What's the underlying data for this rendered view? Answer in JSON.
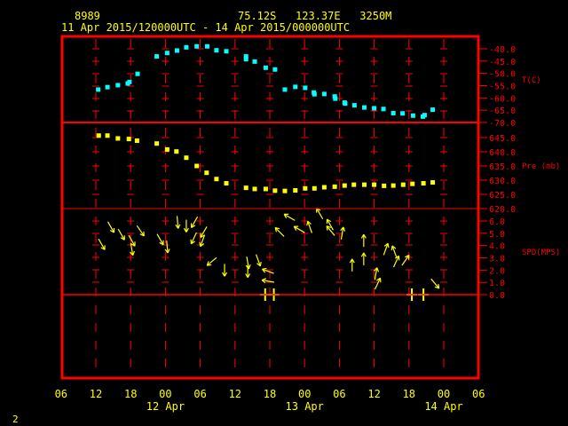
{
  "header": {
    "station_id": "8989",
    "location": "75.12S   123.37E   3250M",
    "period": "11 Apr 2015/120000UTC - 14 Apr 2015/000000UTC"
  },
  "page_number": "2",
  "colors": {
    "frame": "#ff0000",
    "temperature": "#00ffff",
    "pressure": "#ffff00",
    "wind": "#ffff00",
    "text": "#ffff00"
  },
  "chart_data": [
    {
      "type": "scatter",
      "title": "Temperature",
      "ylabel": "T(C)",
      "ylim": [
        -70,
        -40
      ],
      "yticks": [
        "-40.0",
        "-45.0",
        "-50.0",
        "-55.0",
        "-60.0",
        "-65.0",
        "-70.0"
      ],
      "x_units": "hours since 11 Apr 2015 00UTC",
      "points": [
        [
          12.4,
          -56.6
        ],
        [
          14.0,
          -55.6
        ],
        [
          15.8,
          -54.8
        ],
        [
          17.5,
          -54.1
        ],
        [
          17.8,
          -53.5
        ],
        [
          19.2,
          -50.2
        ],
        [
          22.5,
          -43.1
        ],
        [
          24.3,
          -41.7
        ],
        [
          26.0,
          -40.7
        ],
        [
          27.6,
          -39.4
        ],
        [
          29.4,
          -39.0
        ],
        [
          31.2,
          -39.0
        ],
        [
          32.8,
          -40.6
        ],
        [
          34.5,
          -41.0
        ],
        [
          37.9,
          -43.1
        ],
        [
          37.9,
          -44.2
        ],
        [
          39.4,
          -45.2
        ],
        [
          41.3,
          -47.7
        ],
        [
          42.9,
          -48.4
        ],
        [
          44.6,
          -56.6
        ],
        [
          46.4,
          -55.5
        ],
        [
          48.1,
          -55.9
        ],
        [
          49.6,
          -57.8
        ],
        [
          49.7,
          -58.5
        ],
        [
          51.4,
          -58.4
        ],
        [
          53.2,
          -59.4
        ],
        [
          53.3,
          -60.3
        ],
        [
          54.9,
          -61.9
        ],
        [
          55.0,
          -62.3
        ],
        [
          56.6,
          -63.0
        ],
        [
          58.3,
          -63.9
        ],
        [
          60.0,
          -64.2
        ],
        [
          61.6,
          -64.5
        ],
        [
          63.3,
          -66.2
        ],
        [
          64.9,
          -66.3
        ],
        [
          66.7,
          -67.2
        ],
        [
          68.4,
          -67.6
        ],
        [
          68.7,
          -67.0
        ],
        [
          70.1,
          -64.8
        ]
      ]
    },
    {
      "type": "scatter",
      "title": "Pressure",
      "ylabel": "Pre (mb)",
      "ylim": [
        620,
        645
      ],
      "yticks": [
        "645.0",
        "640.0",
        "635.0",
        "630.0",
        "625.0",
        "620.0"
      ],
      "points": [
        [
          12.5,
          645.7
        ],
        [
          14.0,
          645.7
        ],
        [
          15.8,
          644.7
        ],
        [
          17.7,
          644.5
        ],
        [
          19.1,
          643.9
        ],
        [
          22.5,
          642.9
        ],
        [
          24.3,
          640.8
        ],
        [
          25.9,
          640.1
        ],
        [
          27.6,
          637.9
        ],
        [
          29.4,
          635.0
        ],
        [
          31.1,
          632.6
        ],
        [
          32.8,
          630.4
        ],
        [
          34.5,
          628.9
        ],
        [
          37.9,
          627.3
        ],
        [
          39.4,
          626.9
        ],
        [
          41.3,
          626.9
        ],
        [
          42.9,
          626.3
        ],
        [
          44.6,
          626.2
        ],
        [
          46.4,
          626.4
        ],
        [
          48.1,
          627.1
        ],
        [
          49.7,
          627.1
        ],
        [
          51.4,
          627.5
        ],
        [
          53.2,
          627.7
        ],
        [
          54.9,
          628.1
        ],
        [
          56.5,
          628.4
        ],
        [
          58.3,
          628.4
        ],
        [
          60.0,
          628.4
        ],
        [
          61.7,
          628.0
        ],
        [
          63.3,
          628.1
        ],
        [
          65.0,
          628.4
        ],
        [
          66.6,
          628.7
        ],
        [
          68.5,
          628.9
        ],
        [
          70.1,
          629.2
        ]
      ]
    },
    {
      "type": "scatter",
      "title": "Wind",
      "ylabel": "SPD(MPS)",
      "ylim": [
        0,
        6
      ],
      "yticks": [
        "6.0",
        "5.0",
        "4.0",
        "3.0",
        "2.0",
        "1.0",
        "0.0"
      ],
      "arrows": [
        [
          13.0,
          4.1,
          150
        ],
        [
          14.6,
          5.5,
          150
        ],
        [
          16.4,
          4.9,
          150
        ],
        [
          18.2,
          4.4,
          150
        ],
        [
          18.2,
          3.7,
          170
        ],
        [
          19.7,
          5.2,
          145
        ],
        [
          23.1,
          4.5,
          150
        ],
        [
          24.3,
          3.9,
          175
        ],
        [
          26.1,
          5.9,
          175
        ],
        [
          27.6,
          5.6,
          180
        ],
        [
          29.0,
          5.9,
          210
        ],
        [
          28.9,
          4.6,
          205
        ],
        [
          30.6,
          5.1,
          210
        ],
        [
          30.4,
          4.4,
          200
        ],
        [
          32.0,
          2.7,
          230
        ],
        [
          34.2,
          2.0,
          180
        ],
        [
          38.2,
          2.6,
          170
        ],
        [
          38.2,
          1.9,
          180
        ],
        [
          40.0,
          2.8,
          160
        ],
        [
          41.7,
          1.9,
          290
        ],
        [
          41.7,
          1.1,
          280
        ],
        [
          43.7,
          5.1,
          315
        ],
        [
          45.4,
          6.3,
          300
        ],
        [
          47.1,
          5.3,
          300
        ],
        [
          48.9,
          5.5,
          340
        ],
        [
          50.6,
          6.6,
          330
        ],
        [
          52.4,
          5.7,
          330
        ],
        [
          52.5,
          5.2,
          320
        ],
        [
          54.5,
          5.0,
          10
        ],
        [
          56.2,
          2.4,
          0
        ],
        [
          58.2,
          4.4,
          0
        ],
        [
          58.2,
          2.9,
          0
        ],
        [
          60.3,
          1.7,
          10
        ],
        [
          60.6,
          0.9,
          25
        ],
        [
          62.0,
          3.7,
          20
        ],
        [
          63.5,
          3.5,
          340
        ],
        [
          63.8,
          2.7,
          25
        ],
        [
          65.4,
          2.8,
          35
        ],
        [
          70.5,
          0.9,
          140
        ]
      ],
      "calm_markers": [
        41.2,
        42.7,
        66.5,
        68.5
      ]
    }
  ],
  "x_axis": {
    "tick_labels": [
      "06",
      "12",
      "18",
      "00",
      "06",
      "12",
      "18",
      "00",
      "06",
      "12",
      "18",
      "00",
      "06"
    ],
    "tick_hours": [
      6,
      12,
      18,
      24,
      30,
      36,
      42,
      48,
      54,
      60,
      66,
      72,
      78
    ],
    "date_labels": [
      {
        "label": "12 Apr",
        "hour": 24
      },
      {
        "label": "13 Apr",
        "hour": 48
      },
      {
        "label": "14 Apr",
        "hour": 72
      }
    ]
  }
}
